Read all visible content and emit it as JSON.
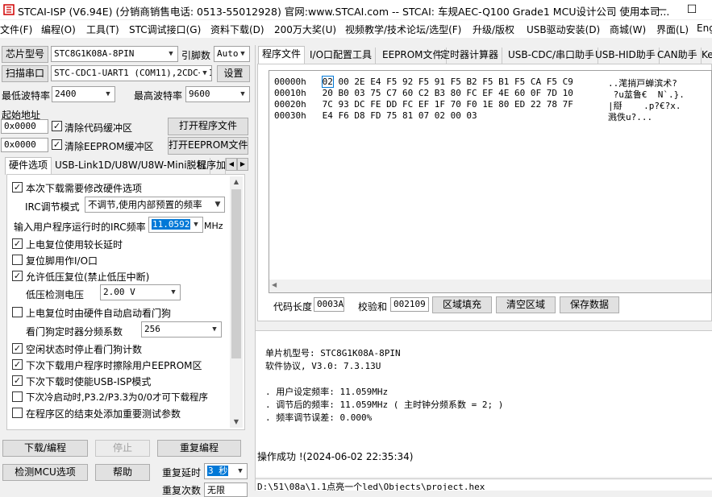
{
  "window": {
    "title": "STCAI-ISP (V6.94E) (分销商销售电话: 0513-55012928) 官网:www.STCAI.com  -- STCAI: 车规AEC-Q100 Grade1 MCU设计公司 使用本司...",
    "minimize": "—",
    "maximize": "☐"
  },
  "menu": [
    "文件(F)",
    "编程(O)",
    "工具(T)",
    "STC调试接口(G)",
    "资料下载(D)",
    "200万大奖(U)",
    "视频教学/技术论坛/选型(F)",
    "升级/版权",
    "USB驱动安装(D)",
    "商城(W)",
    "界面(L)",
    "Eng"
  ],
  "left": {
    "chip_label": "芯片型号",
    "chip_value": "STC8G1K08A-8PIN",
    "pin_label": "引脚数",
    "pin_value": "Auto",
    "scan_label": "扫描串口",
    "port_value": "STC-CDC1-UART1 (COM11),2CDC+HID",
    "settings_label": "设置",
    "min_baud_label": "最低波特率",
    "min_baud_value": "2400",
    "max_baud_label": "最高波特率",
    "max_baud_value": "9600",
    "start_addr_label": "起始地址",
    "addr1": "0x0000",
    "clear_code_label": "清除代码缓冲区",
    "open_prog_label": "打开程序文件",
    "addr2": "0x0000",
    "clear_eeprom_label": "清除EEPROM缓冲区",
    "open_eeprom_label": "打开EEPROM文件",
    "tabs": [
      "硬件选项",
      "USB-Link1D/U8W/U8W-Mini脱机",
      "程序加"
    ],
    "options": {
      "opt1": "本次下载需要修改硬件选项",
      "irc_mode_label": "IRC调节模式",
      "irc_mode_value": "不调节,使用内部预置的频率",
      "irc_freq_label": "输入用户程序运行时的IRC频率",
      "irc_freq_value": "11.0592",
      "irc_unit": "MHz",
      "opt2": "上电复位使用较长延时",
      "opt3": "复位脚用作I/O口",
      "opt4": "允许低压复位(禁止低压中断)",
      "lvd_label": "低压检测电压",
      "lvd_value": "2.00 V",
      "opt5": "上电复位时由硬件自动启动看门狗",
      "wdt_label": "看门狗定时器分频系数",
      "wdt_value": "256",
      "opt6": "空闲状态时停止看门狗计数",
      "opt7": "下次下载用户程序时擦除用户EEPROM区",
      "opt8": "下次下载时使能USB-ISP模式",
      "opt9": "下次冷启动时,P3.2/P3.3为0/0才可下载程序",
      "opt10": "在程序区的结束处添加重要测试参数"
    },
    "download_label": "下载/编程",
    "stop_label": "停止",
    "reprogram_label": "重复编程",
    "check_mcu_label": "检测MCU选项",
    "help_label": "帮助",
    "repeat_delay_label": "重复延时",
    "repeat_delay_value": "3 秒",
    "repeat_count_label": "重复次数",
    "repeat_count_value": "无限"
  },
  "right": {
    "tabs": [
      "程序文件",
      "I/O口配置工具",
      "EEPROM文件",
      "定时器计算器",
      "USB-CDC/串口助手",
      "USB-HID助手",
      "CAN助手",
      "Ke"
    ],
    "hex_rows": [
      {
        "addr": "00000h",
        "bytes": "02 00 2E E4 F5 92 F5 91 F5 B2 F5 B1 F5 CA F5 C9",
        "ascii": "..滗捎戸蝉滨术?"
      },
      {
        "addr": "00010h",
        "bytes": "20 B0 03 75 C7 60 C2 B3 80 FC EF 4E 60 0F 7D 10",
        "ascii": " ?u莁鲁€  N`.}."
      },
      {
        "addr": "00020h",
        "bytes": "7C 93 DC FE DD FC EF 1F 70 F0 1E 80 ED 22 78 7F",
        "ascii": "|搿    .p?€?x."
      },
      {
        "addr": "00030h",
        "bytes": "E4 F6 D8 FD 75 81 07 02 00 03",
        "ascii": "溅佚u?..."
      }
    ],
    "code_len_label": "代码长度",
    "code_len_value": "0003A",
    "checksum_label": "校验和",
    "checksum_value": "002109",
    "fill_label": "区域填充",
    "clear_label": "清空区域",
    "save_label": "保存数据"
  },
  "log": {
    "lines": [
      "单片机型号: STC8G1K08A-8PIN",
      "软件协议, V3.0: 7.3.13U",
      "",
      ". 用户设定频率: 11.059MHz",
      ". 调节后的频率: 11.059MHz ( 主时钟分频系数 = 2; )",
      ". 频率调节误差: 0.000%",
      "",
      "",
      "操作成功 !(2024-06-02 22:35:34)"
    ]
  },
  "status": {
    "path": "D:\\51\\08a\\1.1点亮一个led\\Objects\\project.hex"
  },
  "colors": {
    "accent": "#0078d7",
    "red": "#d00000"
  }
}
